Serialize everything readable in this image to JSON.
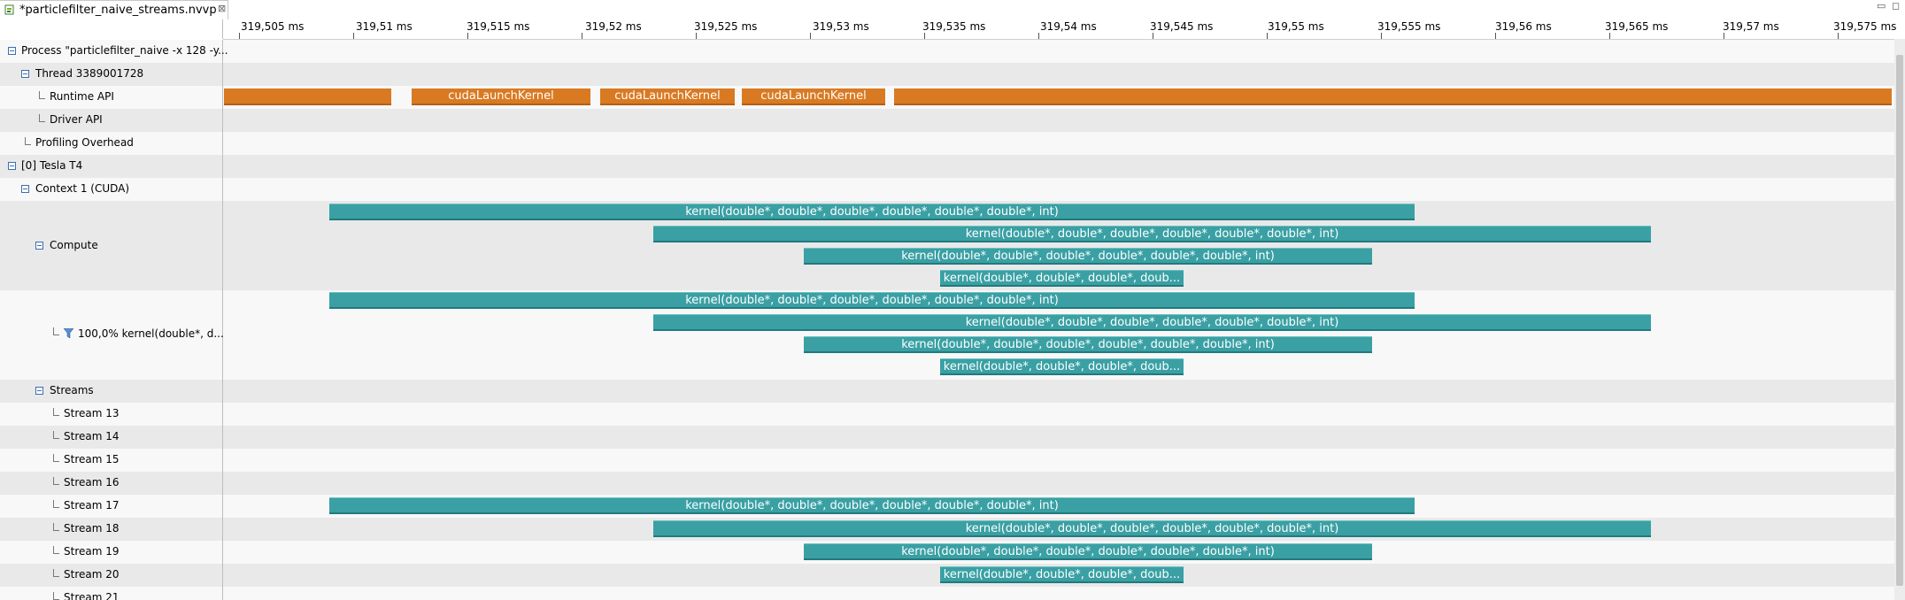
{
  "tab": {
    "title": "*particlefilter_naive_streams.nvvp",
    "close": "⊠"
  },
  "window_controls": {
    "minimize": "▭",
    "maximize": "◻"
  },
  "ruler": {
    "ticks": [
      "319,505 ms",
      "319,51 ms",
      "319,515 ms",
      "319,52 ms",
      "319,525 ms",
      "319,53 ms",
      "319,535 ms",
      "319,54 ms",
      "319,545 ms",
      "319,55 ms",
      "319,555 ms",
      "319,56 ms",
      "319,565 ms",
      "319,57 ms",
      "319,575 ms"
    ]
  },
  "rows": {
    "process": "Process \"particlefilter_naive -x 128 -y...",
    "thread": "Thread 3389001728",
    "runtime_api": "Runtime API",
    "driver_api": "Driver API",
    "profiling_overhead": "Profiling Overhead",
    "device": "[0] Tesla T4",
    "context": "Context 1 (CUDA)",
    "compute": "Compute",
    "kernel_filter": "100,0% kernel(double*, d...",
    "streams": "Streams",
    "stream13": "Stream 13",
    "stream14": "Stream 14",
    "stream15": "Stream 15",
    "stream16": "Stream 16",
    "stream17": "Stream 17",
    "stream18": "Stream 18",
    "stream19": "Stream 19",
    "stream20": "Stream 20",
    "stream21": "Stream 21"
  },
  "bars": {
    "api": {
      "blank": "",
      "launch": "cudaLaunchKernel"
    },
    "kernel_full": "kernel(double*, double*, double*, double*, double*, double*, int)",
    "kernel_short": "kernel(double*, double*, double*, doub..."
  }
}
